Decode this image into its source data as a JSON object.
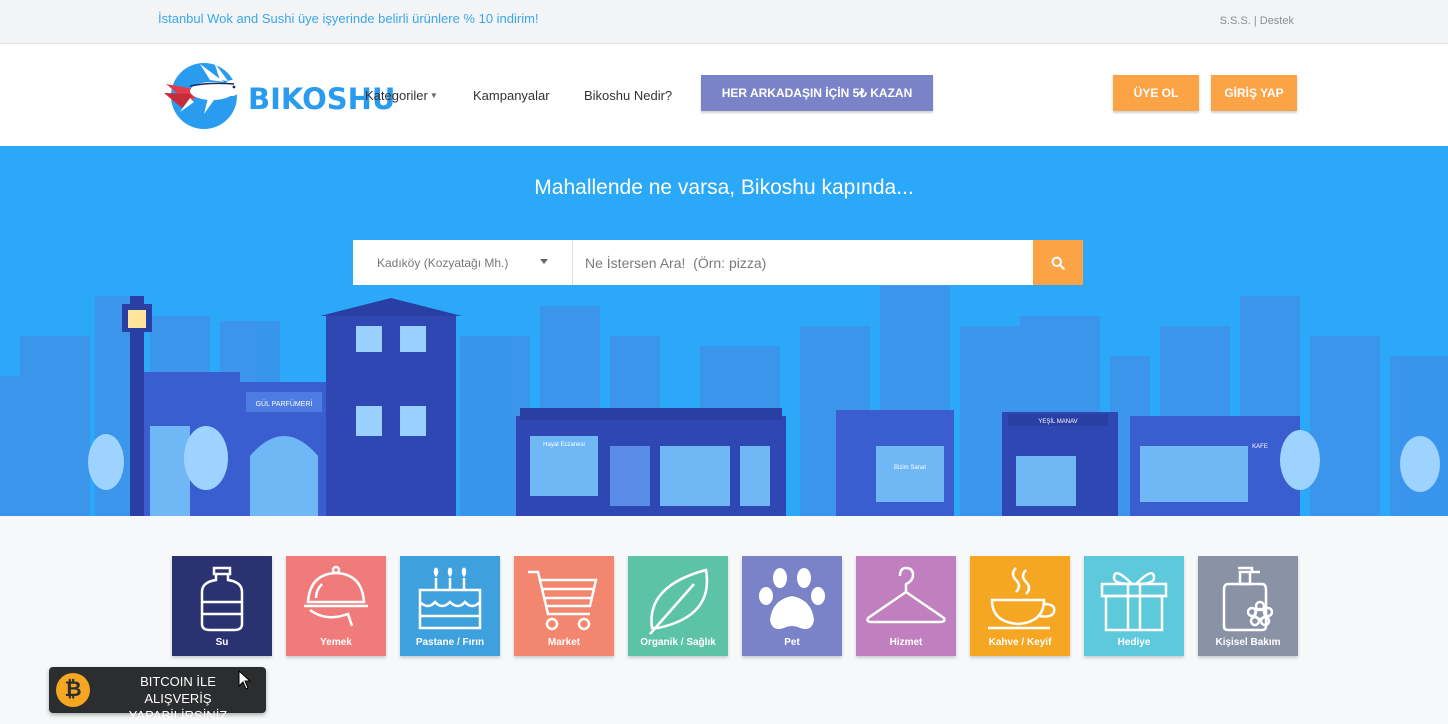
{
  "topbar": {
    "promo": "İstanbul Wok and Sushi üye işyerinde belirli ürünlere % 10 indirim!",
    "links": [
      "S.S.S.",
      "Destek"
    ],
    "separator": " | "
  },
  "header": {
    "logo_text": "BIKOSHU",
    "nav": [
      {
        "label": "Kategoriler",
        "has_dropdown": true
      },
      {
        "label": "Kampanyalar"
      },
      {
        "label": "Bikoshu Nedir?"
      }
    ],
    "invite_button": "HER ARKADAŞIN İÇİN 5₺ KAZAN",
    "signup_button": "ÜYE OL",
    "login_button": "GİRİŞ YAP"
  },
  "hero": {
    "title": "Mahallende ne varsa, Bikoshu kapında...",
    "location_value": "Kadıköy (Kozyatağı Mh.)",
    "search_placeholder": "Ne İstersen Ara!  (Örn: pizza)",
    "storefront_signs": [
      "GÜL PARFÜMERİ",
      "Hayat Eczanesi",
      "Bizim Sanat",
      "YEŞİL MANAV",
      "KAFE"
    ]
  },
  "categories": [
    {
      "label": "Su",
      "color": "#2a3370",
      "icon": "water-bottle-icon"
    },
    {
      "label": "Yemek",
      "color": "#ef7b7b",
      "icon": "food-cloche-icon"
    },
    {
      "label": "Pastane / Fırın",
      "color": "#3ea0dc",
      "icon": "birthday-cake-icon"
    },
    {
      "label": "Market",
      "color": "#f2866e",
      "icon": "shopping-cart-icon"
    },
    {
      "label": "Organik / Sağlık",
      "color": "#5dc3a6",
      "icon": "leaf-icon"
    },
    {
      "label": "Pet",
      "color": "#7b83c8",
      "icon": "paw-icon"
    },
    {
      "label": "Hizmet",
      "color": "#c07fbe",
      "icon": "hanger-icon"
    },
    {
      "label": "Kahve / Keyif",
      "color": "#f5a623",
      "icon": "coffee-cup-icon"
    },
    {
      "label": "Hediye",
      "color": "#5ec9da",
      "icon": "gift-icon"
    },
    {
      "label": "Kişisel Bakım",
      "color": "#8a93a6",
      "icon": "soap-bottle-icon"
    }
  ],
  "bitcoin_badge": {
    "line1": "BITCOIN İLE",
    "line2": "ALIŞVERİŞ YAPABİLİRSİNİZ",
    "icon_glyph": "₿"
  },
  "colors": {
    "brand_blue": "#2ba8f7",
    "accent_orange": "#fca345",
    "invite_purple": "#7b83c8"
  }
}
